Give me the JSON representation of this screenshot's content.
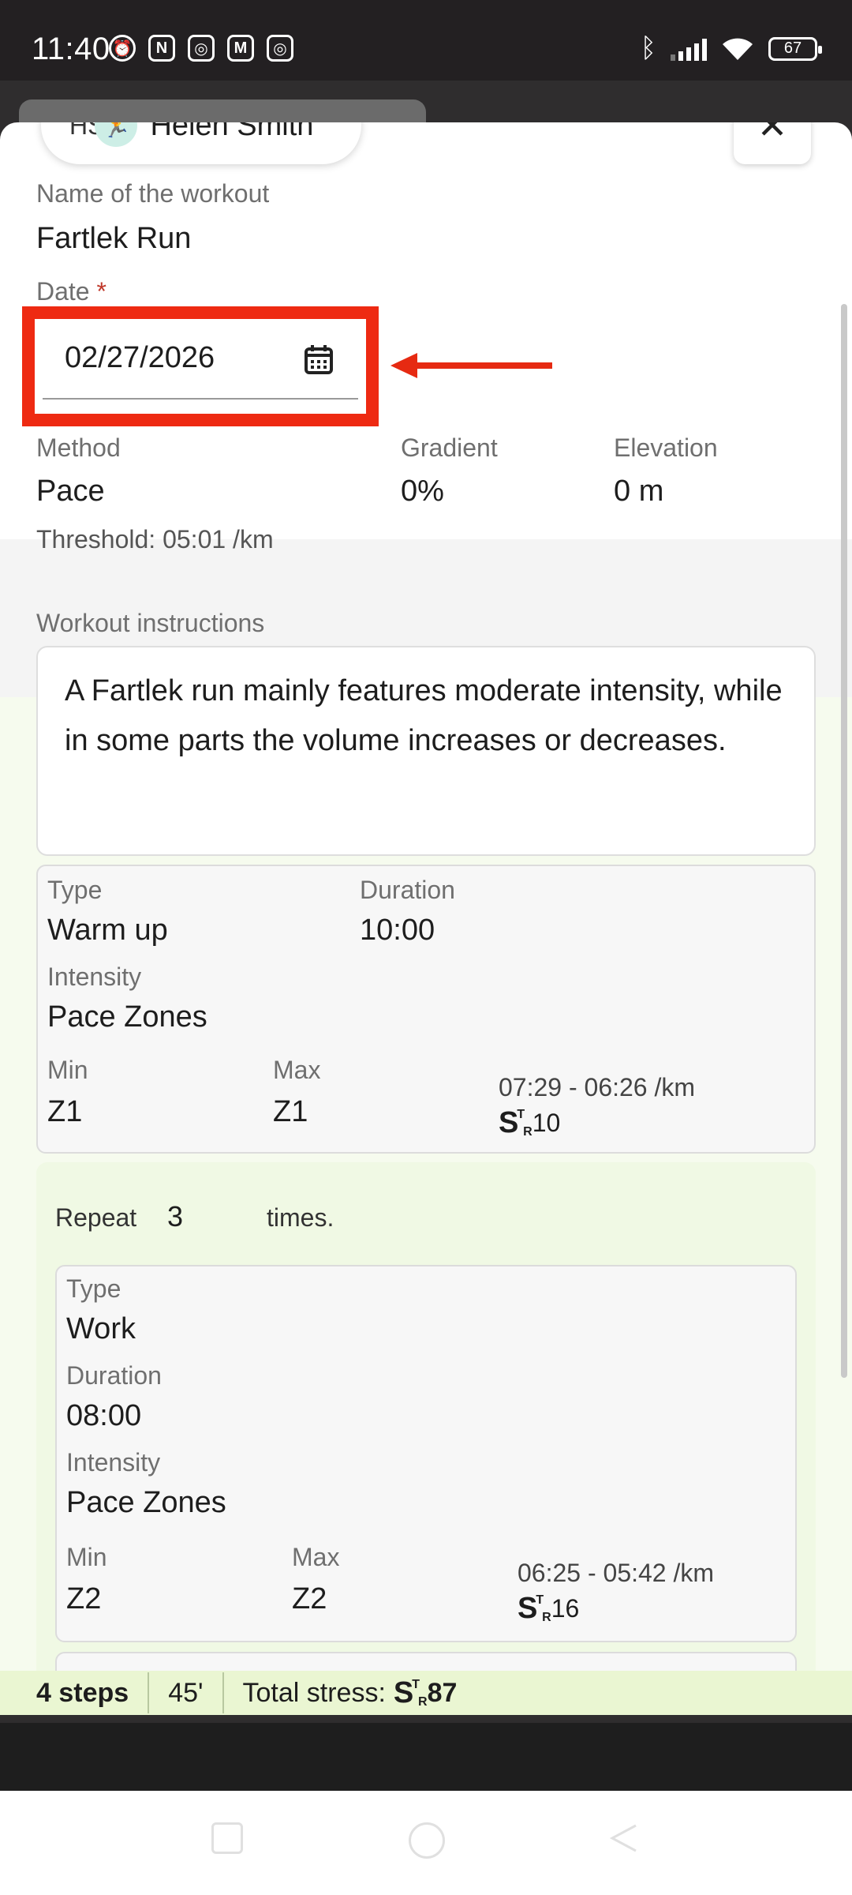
{
  "status_bar": {
    "time": "11:40",
    "battery": "67"
  },
  "header": {
    "avatar_initials": "HS",
    "user_name": "Helen Smith",
    "close_label": "✕"
  },
  "workout": {
    "name_label": "Name of the workout",
    "name_value": "Fartlek Run",
    "date_label": "Date",
    "date_required_mark": "*",
    "date_value": "02/27/2026",
    "method_label": "Method",
    "method_value": "Pace",
    "gradient_label": "Gradient",
    "gradient_value": "0%",
    "elevation_label": "Elevation",
    "elevation_value": "0 m",
    "threshold": "Threshold: 05:01 /km",
    "instructions_label": "Workout instructions",
    "instructions_text": "A Fartlek run mainly features moderate intensity, while in some parts the volume increases or decreases."
  },
  "steps": [
    {
      "type_label": "Type",
      "type_value": "Warm up",
      "duration_label": "Duration",
      "duration_value": "10:00",
      "intensity_label": "Intensity",
      "intensity_value": "Pace Zones",
      "min_label": "Min",
      "min_value": "Z1",
      "max_label": "Max",
      "max_value": "Z1",
      "pace_range": "07:29 - 06:26 /km",
      "stress": "10"
    },
    {
      "type_label": "Type",
      "type_value": "Work",
      "duration_label": "Duration",
      "duration_value": "08:00",
      "intensity_label": "Intensity",
      "intensity_value": "Pace Zones",
      "min_label": "Min",
      "min_value": "Z2",
      "max_label": "Max",
      "max_value": "Z2",
      "pace_range": "06:25 - 05:42 /km",
      "stress": "16"
    }
  ],
  "repeat": {
    "prefix": "Repeat",
    "count": "3",
    "suffix": "times."
  },
  "footer": {
    "steps": "4 steps",
    "duration": "45'",
    "total_stress_label": "Total stress:",
    "total_stress_value": "87"
  },
  "colors": {
    "highlight": "#ee2a12",
    "footer_bg": "#eaf6d2",
    "repeat_bg": "#f0f9e4"
  }
}
